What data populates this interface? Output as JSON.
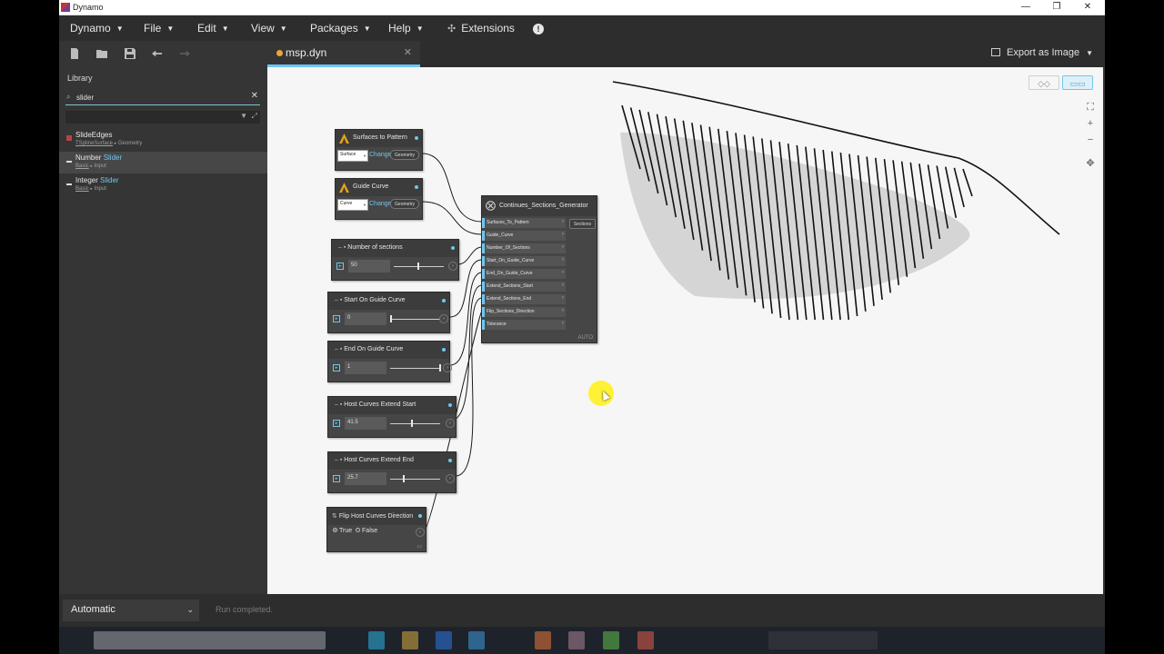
{
  "window": {
    "title": "Dynamo",
    "minimize": "—",
    "restore": "❐",
    "close": "✕"
  },
  "menu": {
    "items": [
      {
        "label": "Dynamo"
      },
      {
        "label": "File"
      },
      {
        "label": "Edit"
      },
      {
        "label": "View"
      },
      {
        "label": "Packages"
      },
      {
        "label": "Help"
      }
    ],
    "extensions": "Extensions"
  },
  "tab": {
    "label": "msp.dyn",
    "close": "✕"
  },
  "export": {
    "label": "Export as Image"
  },
  "library": {
    "title": "Library",
    "search_value": "slider",
    "items": [
      {
        "name_plain": "SlideEdges",
        "name_hl": "",
        "category_link": "TSplineSurface",
        "category_rest": "Geometry"
      },
      {
        "name_plain": "Number ",
        "name_hl": "Slider",
        "category_link": "Basic",
        "category_rest": "Input"
      },
      {
        "name_plain": "Integer ",
        "name_hl": "Slider",
        "category_link": "Basic",
        "category_rest": "Input"
      }
    ]
  },
  "nodes": {
    "surfaces": {
      "title": "Surfaces to Pattern",
      "dropdown": "Surface",
      "change": "Change",
      "output": "Geometry"
    },
    "guide": {
      "title": "Guide Curve",
      "dropdown": "Curve",
      "change": "Change",
      "output": "Geometry"
    },
    "num_sections": {
      "title": "Number of sections",
      "value": "50"
    },
    "start_guide": {
      "title": "Start On Guide Curve",
      "value": "0"
    },
    "end_guide": {
      "title": "End On Guide Curve",
      "value": "1"
    },
    "extend_start": {
      "title": "Host Curves Extend Start",
      "value": "41.5"
    },
    "extend_end": {
      "title": "Host Curves Extend End",
      "value": "25.7"
    },
    "flip": {
      "title": "Flip Host Curves Direction",
      "true_label": "True",
      "false_label": "False"
    },
    "generator": {
      "title": "Continues_Sections_Generator",
      "inputs": [
        "Surfaces_To_Pattern",
        "Guide_Curve",
        "Number_Of_Sections",
        "Start_On_Guide_Curve",
        "End_On_Guide_Curve",
        "Extend_Sections_Start",
        "Extend_Sections_End",
        "Flip_Sections_Direction",
        "Tolerance"
      ],
      "output": "Sections",
      "lacing": "AUTO"
    }
  },
  "status": {
    "run_mode": "Automatic",
    "message": "Run completed."
  },
  "colors": {
    "accent": "#6ec7f0",
    "tab_dot": "#f0a43c",
    "cursor_highlight": "#fff014"
  }
}
